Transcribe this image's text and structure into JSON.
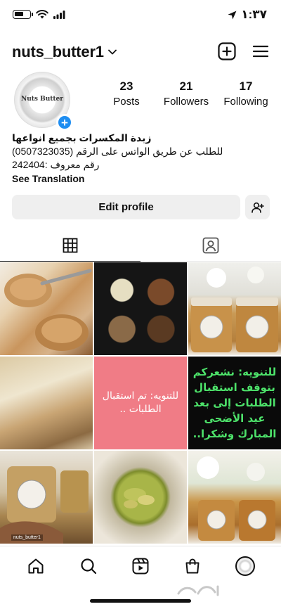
{
  "status_bar": {
    "time": "١:٣٧",
    "icons": [
      "battery-icon",
      "wifi-icon",
      "signal-icon",
      "location-arrow-icon"
    ]
  },
  "header": {
    "username": "nuts_butter1",
    "icons": [
      "chevron-down-icon",
      "new-post-icon",
      "menu-icon"
    ]
  },
  "profile": {
    "avatar_text": "Nuts Butter",
    "stats": [
      {
        "value": "23",
        "label": "Posts"
      },
      {
        "value": "21",
        "label": "Followers"
      },
      {
        "value": "17",
        "label": "Following"
      }
    ],
    "bio": {
      "name": "زبدة المكسرات بجميع انواعها",
      "line1": "للطلب عن طريق الواتس على الرقم (0507323035)",
      "line2": "رقم معروف :242404",
      "see_translation": "See Translation"
    }
  },
  "actions": {
    "edit_profile": "Edit profile",
    "add_person_icon": "add-person-icon"
  },
  "tabs": [
    {
      "icon": "grid-icon",
      "active": true
    },
    {
      "icon": "tagged-icon",
      "active": false
    }
  ],
  "posts": [
    {
      "type": "photo",
      "subject": "peanut-butter-toast"
    },
    {
      "type": "photo",
      "subject": "assorted-nuts"
    },
    {
      "type": "photo",
      "subject": "nut-butter-jars"
    },
    {
      "type": "photo",
      "subject": "bread-slice"
    },
    {
      "type": "text",
      "text": "للتنويه: تم استقبال الطلبات .."
    },
    {
      "type": "text",
      "text": "للتنويه: نشعركم بتوقف استقبال الطلبات إلى بعد عيد الأضحى المبارك وشكرا.."
    },
    {
      "type": "photo",
      "subject": "jar-in-hand",
      "tag": "nuts_butter1"
    },
    {
      "type": "photo",
      "subject": "pistachio-butter"
    },
    {
      "type": "photo",
      "subject": "jars-with-flowers"
    }
  ],
  "bottom_nav": [
    "home-icon",
    "search-icon",
    "reels-icon",
    "shop-icon",
    "profile-avatar"
  ],
  "colors": {
    "accent_blue": "#1f8ef1",
    "pink_post": "#f07c86",
    "green_text": "#4de26a",
    "button_gray": "#efefef"
  }
}
